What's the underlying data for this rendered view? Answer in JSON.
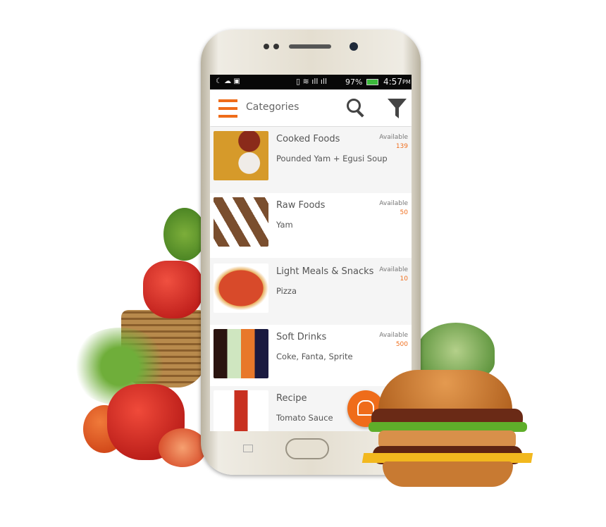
{
  "status_bar": {
    "battery": "97%",
    "time": "4:57",
    "ampm": "PM"
  },
  "app_bar": {
    "title": "Categories",
    "menu_icon": "hamburger-icon",
    "search_icon": "search-icon",
    "filter_icon": "filter-icon"
  },
  "accent": "#ef6c1a",
  "available_label": "Available",
  "categories": [
    {
      "title": "Cooked Foods",
      "subtitle": "Pounded Yam + Egusi Soup",
      "count": "139"
    },
    {
      "title": "Raw Foods",
      "subtitle": "Yam",
      "count": "50"
    },
    {
      "title": "Light Meals & Snacks",
      "subtitle": "Pizza",
      "count": "10"
    },
    {
      "title": "Soft Drinks",
      "subtitle": "Coke, Fanta, Sprite",
      "count": "500"
    },
    {
      "title": "Recipe",
      "subtitle": "Tomato Sauce",
      "count": ""
    }
  ],
  "fab_icon": "cart-icon"
}
